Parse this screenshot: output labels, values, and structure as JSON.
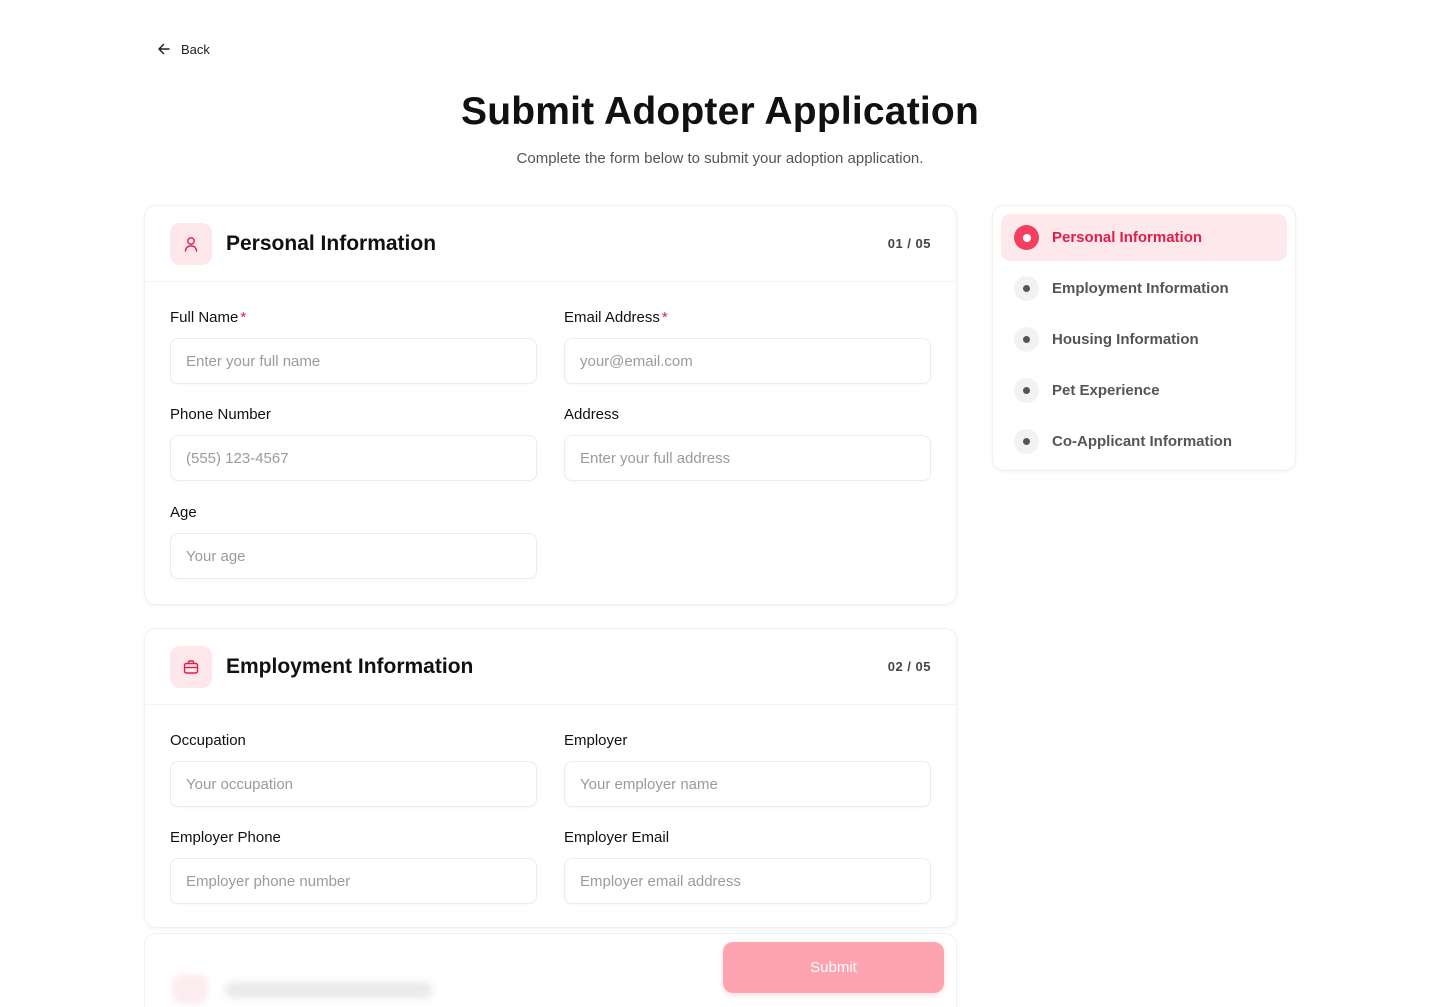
{
  "back": {
    "label": "Back"
  },
  "header": {
    "title": "Submit Adopter Application",
    "subtitle": "Complete the form below to submit your adoption application."
  },
  "sections": [
    {
      "title": "Personal Information",
      "step": "01 / 05",
      "icon": "user-icon",
      "fields": [
        {
          "label": "Full Name",
          "required": "*",
          "placeholder": "Enter your full name"
        },
        {
          "label": "Email Address",
          "required": "*",
          "placeholder": "your@email.com"
        },
        {
          "label": "Phone Number",
          "placeholder": "(555) 123-4567"
        },
        {
          "label": "Address",
          "placeholder": "Enter your full address"
        },
        {
          "label": "Age",
          "placeholder": "Your age"
        }
      ]
    },
    {
      "title": "Employment Information",
      "step": "02 / 05",
      "icon": "briefcase-icon",
      "fields": [
        {
          "label": "Occupation",
          "placeholder": "Your occupation"
        },
        {
          "label": "Employer",
          "placeholder": "Your employer name"
        },
        {
          "label": "Employer Phone",
          "placeholder": "Employer phone number"
        },
        {
          "label": "Employer Email",
          "placeholder": "Employer email address"
        }
      ]
    }
  ],
  "nav": {
    "items": [
      {
        "label": "Personal Information",
        "active": true
      },
      {
        "label": "Employment Information"
      },
      {
        "label": "Housing Information"
      },
      {
        "label": "Pet Experience"
      },
      {
        "label": "Co-Applicant Information"
      }
    ]
  },
  "submit": {
    "label": "Submit"
  },
  "colors": {
    "accent": "#e11d48",
    "accent_light": "#fde8ec",
    "submit_bg": "#fda4b0"
  }
}
